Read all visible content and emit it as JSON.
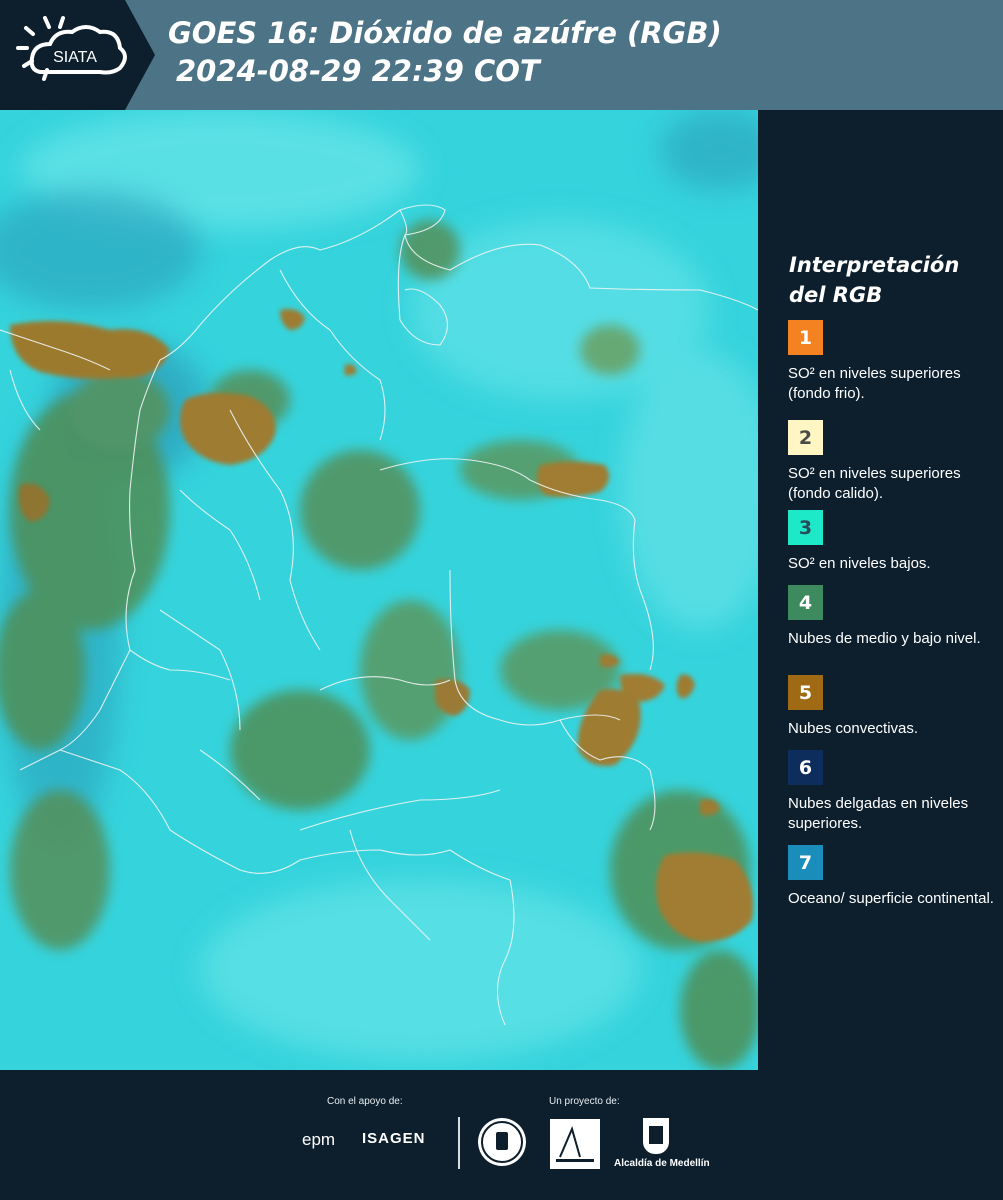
{
  "header": {
    "logo_text": "SIATA",
    "title_line1": "GOES 16: Dióxido de azúfre (RGB)",
    "title_line2": "2024-08-29 22:39 COT"
  },
  "legend": {
    "title": "Interpretación del RGB",
    "items": [
      {
        "number": "1",
        "text": "SO² en niveles superiores (fondo frio).",
        "color": "#f58220",
        "number_color": "#ffffff"
      },
      {
        "number": "2",
        "text": "SO² en niveles superiores (fondo calido).",
        "color": "#fff6c4",
        "number_color": "#4a4a4a"
      },
      {
        "number": "3",
        "text": "SO² en niveles bajos.",
        "color": "#1de9c9",
        "number_color": "#2a4a5a"
      },
      {
        "number": "4",
        "text": "Nubes de medio y bajo nivel.",
        "color": "#3d8a5e",
        "number_color": "#ffffff"
      },
      {
        "number": "5",
        "text": "Nubes convectivas.",
        "color": "#a06a14",
        "number_color": "#ffffff"
      },
      {
        "number": "6",
        "text": "Nubes delgadas en niveles superiores.",
        "color": "#0d2d5c",
        "number_color": "#ffffff"
      },
      {
        "number": "7",
        "text": "Oceano/ superficie continental.",
        "color": "#1b8dbb",
        "number_color": "#ffffff"
      }
    ]
  },
  "footer": {
    "support_label": "Con el apoyo de:",
    "project_label": "Un proyecto de:",
    "sponsor_epm": "epm",
    "sponsor_isagen": "ISAGEN",
    "alcaldia_label": "Alcaldía de Medellín"
  },
  "map_colors": {
    "background": "#2fd3dc",
    "green_cloud": "#4f8f56",
    "convective": "#9b7a2e",
    "borders": "#f0f4f4"
  }
}
